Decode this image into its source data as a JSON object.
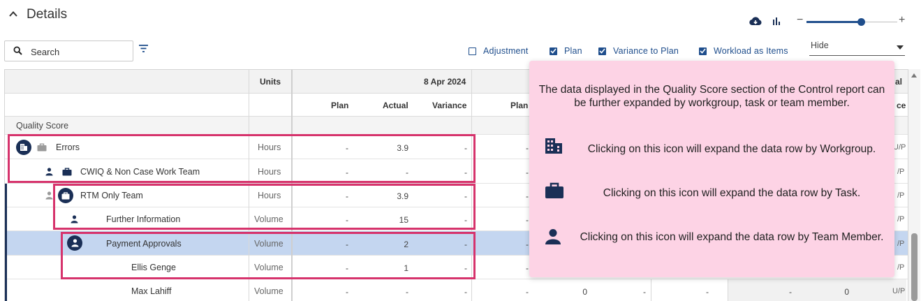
{
  "header": {
    "title": "Details"
  },
  "toolbar": {
    "zoom_minus": "−",
    "zoom_plus": "+",
    "zoom_level": 0.6
  },
  "search": {
    "placeholder": "Search"
  },
  "options": [
    {
      "label": "Adjustment",
      "checked": false
    },
    {
      "label": "Plan",
      "checked": true
    },
    {
      "label": "Variance to Plan",
      "checked": true
    },
    {
      "label": "Workload as Items",
      "checked": true
    }
  ],
  "hide_select": {
    "value": "Hide"
  },
  "grid": {
    "units_header": "Units",
    "date_header": "8 Apr 2024",
    "right_header_fragment": "al",
    "sub_headers": [
      "Plan",
      "Actual",
      "Variance",
      "Plan"
    ],
    "right_sub_fragment": "ce",
    "group_label": "Quality Score",
    "rows": [
      {
        "label": "Errors",
        "units": "Hours",
        "plan": "-",
        "actual": "3.9",
        "variance": "-",
        "plan2": "-",
        "tail": "U/P"
      },
      {
        "label": "CWIQ & Non Case Work Team",
        "units": "Hours",
        "plan": "-",
        "actual": "-",
        "variance": "-",
        "plan2": "-",
        "tail": "/P"
      },
      {
        "label": "RTM Only Team",
        "units": "Hours",
        "plan": "-",
        "actual": "3.9",
        "variance": "-",
        "plan2": "-",
        "tail": "/P"
      },
      {
        "label": "Further Information",
        "units": "Volume",
        "plan": "-",
        "actual": "15",
        "variance": "-",
        "plan2": "-",
        "tail": "/P"
      },
      {
        "label": "Payment Approvals",
        "units": "Volume",
        "plan": "-",
        "actual": "2",
        "variance": "-",
        "plan2": "-",
        "tail": "/P"
      },
      {
        "label": "Ellis Genge",
        "units": "Volume",
        "plan": "-",
        "actual": "1",
        "variance": "-",
        "plan2": "-",
        "tail": "/P"
      },
      {
        "label": "Max Lahiff",
        "units": "Volume",
        "plan": "-",
        "actual": "-",
        "variance": "-",
        "plan2": "-",
        "extra1": "0",
        "extra2": "-",
        "extra3": "-",
        "extra4": "-",
        "extra5": "0",
        "tail": "U/P"
      }
    ]
  },
  "tooltip": {
    "intro": "The data displayed in the Quality Score section of the Control report can be further expanded by workgroup, task or team member.",
    "items": [
      {
        "icon": "building-icon",
        "text": "Clicking on this icon will expand the data row by Workgroup."
      },
      {
        "icon": "briefcase-icon",
        "text": "Clicking on this icon will expand the data row by Task."
      },
      {
        "icon": "person-icon",
        "text": "Clicking on this icon will expand the data row by Team Member."
      }
    ]
  },
  "colors": {
    "accent": "#1f4e8c",
    "navy": "#1a2f56",
    "highlight": "#d6336c",
    "tooltip_bg": "#fdd3e5",
    "selected_row": "#c4d6f0"
  }
}
